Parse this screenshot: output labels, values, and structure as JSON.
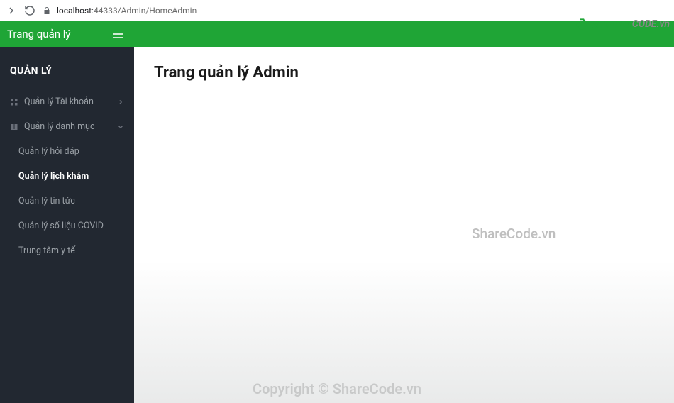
{
  "browser": {
    "host": "localhost:",
    "port": "44333",
    "path": "/Admin/HomeAdmin"
  },
  "header": {
    "brand": "Trang quản lý"
  },
  "sidebar": {
    "title": "QUẢN LÝ",
    "items": [
      {
        "label": "Quản lý Tài khoản",
        "icon": "grid-icon",
        "arrow": "right"
      },
      {
        "label": "Quản lý danh mục",
        "icon": "book-icon",
        "arrow": "down"
      }
    ],
    "sub": [
      {
        "label": "Quản lý hỏi đáp",
        "active": false
      },
      {
        "label": "Quản lý lịch khám",
        "active": true
      },
      {
        "label": "Quản lý tin tức",
        "active": false
      },
      {
        "label": "Quản lý số liệu COVID",
        "active": false
      },
      {
        "label": "Trung tâm y tế",
        "active": false
      }
    ]
  },
  "main": {
    "title": "Trang quản lý Admin"
  },
  "watermark": {
    "center": "ShareCode.vn",
    "bottom": "Copyright © ShareCode.vn",
    "logo1": "SHARE",
    "logo2": "CODE.vn"
  }
}
